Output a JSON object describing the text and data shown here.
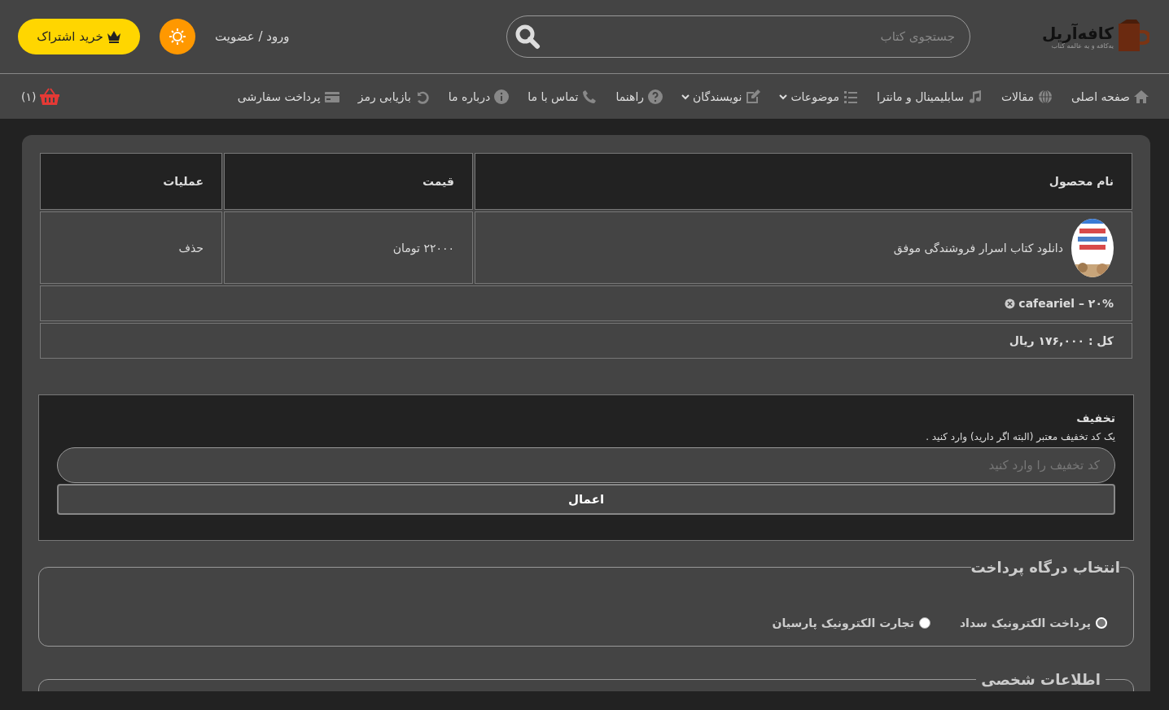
{
  "header": {
    "logo": {
      "name": "کافه‌آریل",
      "tagline": "یه‌کافه و یه عالمه کتاب"
    },
    "search": {
      "placeholder": "جستجوی کتاب"
    },
    "login": "ورود / عضویت",
    "subscribe": "خرید اشتراک"
  },
  "nav": {
    "items": [
      {
        "kind": "home",
        "label": "صفحه اصلی",
        "dropdown": false
      },
      {
        "kind": "globe",
        "label": "مقالات",
        "dropdown": false
      },
      {
        "kind": "music",
        "label": "سابلیمینال و مانترا",
        "dropdown": false
      },
      {
        "kind": "list",
        "label": "موضوعات",
        "dropdown": true
      },
      {
        "kind": "edit",
        "label": "نویسندگان",
        "dropdown": true
      },
      {
        "kind": "question",
        "label": "راهنما",
        "dropdown": false
      },
      {
        "kind": "phone",
        "label": "تماس با ما",
        "dropdown": false
      },
      {
        "kind": "info",
        "label": "درباره ما",
        "dropdown": false
      },
      {
        "kind": "undo",
        "label": "بازیابی رمز",
        "dropdown": false
      },
      {
        "kind": "card",
        "label": "پرداخت سفارشی",
        "dropdown": false
      }
    ],
    "cart_count": "(۱)"
  },
  "cart": {
    "columns": [
      "نام محصول",
      "قیمت",
      "عملیات"
    ],
    "rows": [
      {
        "product": "دانلود کتاب اسرار فروشندگی موفق",
        "price": "۲۲۰۰۰ تومان",
        "action": "حذف"
      }
    ],
    "coupon": "cafeariel – ۲۰%",
    "total": "کل : ۱۷۶,۰۰۰ ریال"
  },
  "discount": {
    "title": "تخفیف",
    "hint": "یک کد تخفیف معتبر (البته اگر دارید) وارد کنید .",
    "placeholder": "کد تخفیف را وارد کنید",
    "button": "اعمال"
  },
  "payment": {
    "legend": "انتخاب درگاه پرداخت",
    "options": [
      {
        "label": "پرداخت الکترونیک سداد",
        "selected": true
      },
      {
        "label": "تجارت الکترونیک پارسیان",
        "selected": false
      }
    ]
  },
  "personal": {
    "legend": "اطلاعات شخصی"
  }
}
